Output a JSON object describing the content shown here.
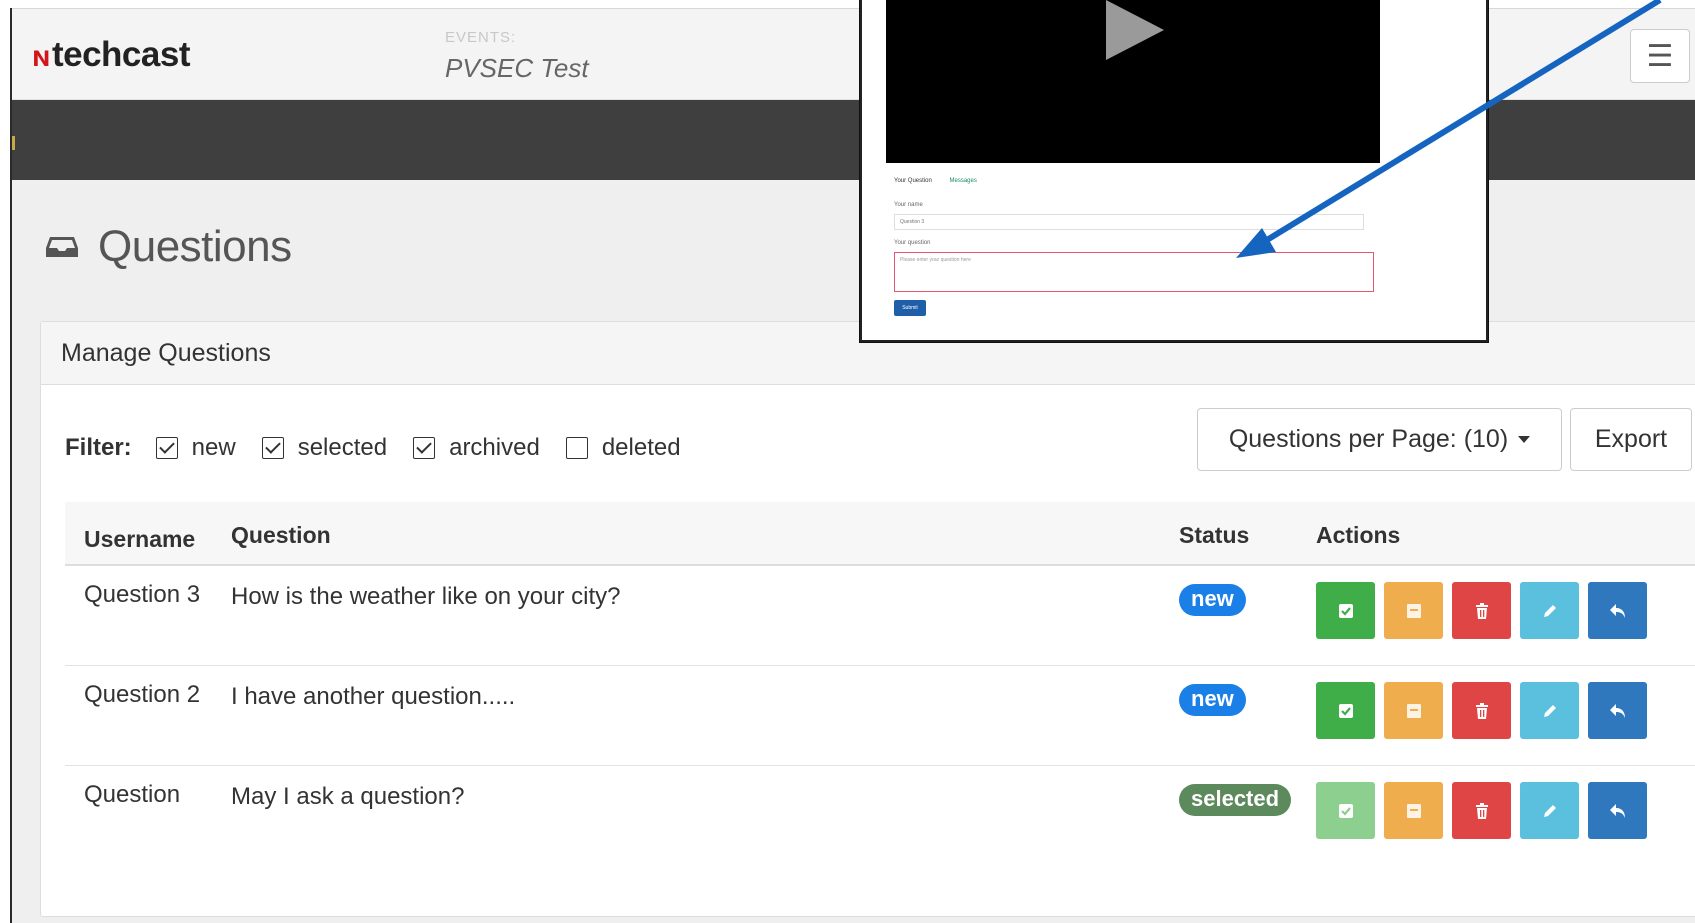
{
  "header": {
    "logo_text": "techcast",
    "event_label": "EVENTS:",
    "event_name": "PVSEC Test"
  },
  "page": {
    "title": "Questions",
    "icon": "inbox-icon"
  },
  "panel": {
    "title": "Manage Questions",
    "filter": {
      "label": "Filter:",
      "options": [
        {
          "label": "new",
          "checked": true
        },
        {
          "label": "selected",
          "checked": true
        },
        {
          "label": "archived",
          "checked": true
        },
        {
          "label": "deleted",
          "checked": false
        }
      ]
    },
    "per_page_label": "Questions per Page: (10)",
    "export_label": "Export",
    "table": {
      "columns": [
        "Username",
        "Question",
        "Status",
        "Actions"
      ],
      "rows": [
        {
          "username": "Question 3",
          "question": "How is the weather like on your city?",
          "status": "new"
        },
        {
          "username": "Question 2",
          "question": "I have another question.....",
          "status": "new"
        },
        {
          "username": "Question",
          "question": "May I ask a question?",
          "status": "selected"
        }
      ]
    }
  },
  "callout": {
    "tabs": [
      "Your Question",
      "Messages"
    ],
    "name_label": "Your name",
    "name_value": "Question 3",
    "question_label": "Your question",
    "question_placeholder": "Please enter your question here",
    "submit_label": "Submit"
  },
  "colors": {
    "status_new": "#1a7fe6",
    "status_selected": "#5c8a5c",
    "arrow": "#1565c0",
    "dark_bar": "#3f3f3f"
  }
}
